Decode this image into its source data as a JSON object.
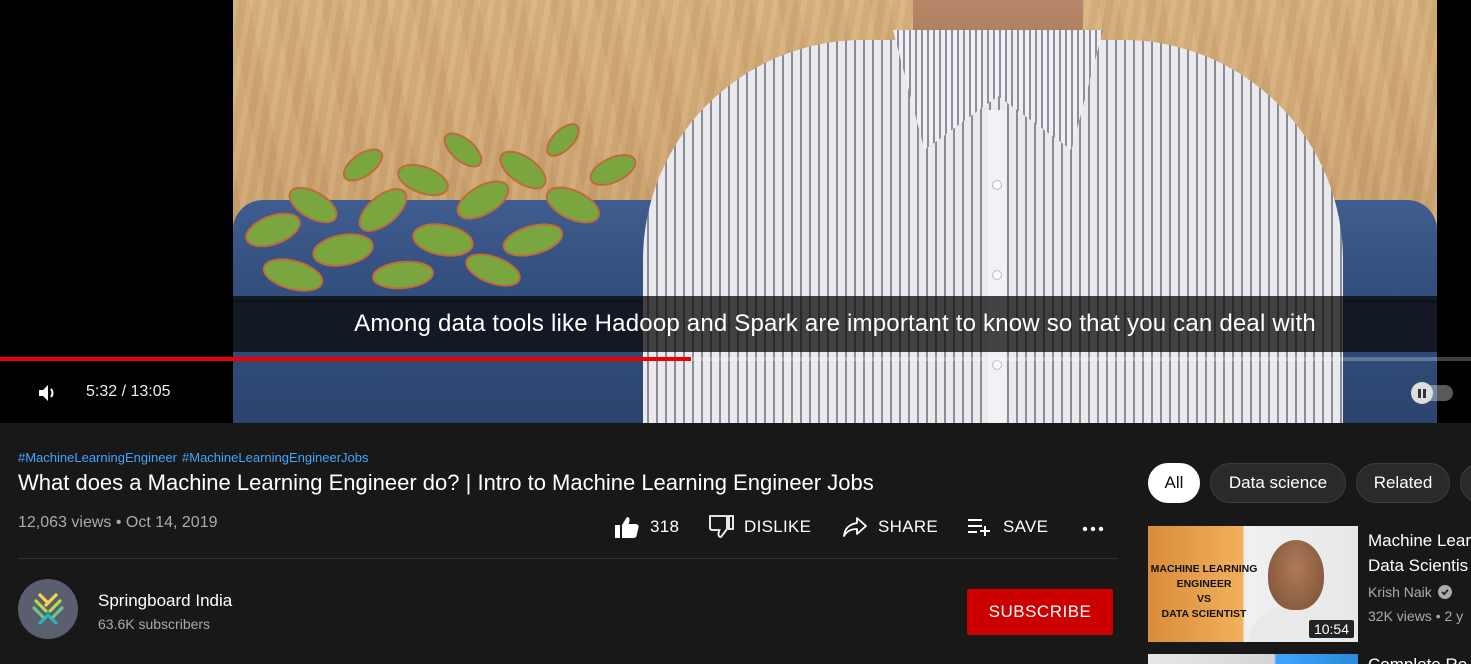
{
  "player": {
    "caption": "Among data tools like Hadoop and Spark are important to know so that you can deal with",
    "current_time": "5:32",
    "duration": "13:05",
    "time_display": "5:32 / 13:05",
    "progress_fraction": 0.47,
    "icons": {
      "volume": "volume-icon",
      "autoplay": "autoplay-toggle-icon"
    },
    "colors": {
      "progress": "#ee0000"
    }
  },
  "video": {
    "hashtags": [
      "#MachineLearningEngineer",
      "#MachineLearningEngineerJobs"
    ],
    "title": "What does a Machine Learning Engineer do? | Intro to Machine Learning Engineer Jobs",
    "views_date": "12,063 views • Oct 14, 2019",
    "actions": {
      "like_count": "318",
      "dislike_label": "DISLIKE",
      "share_label": "SHARE",
      "save_label": "SAVE"
    }
  },
  "channel": {
    "name": "Springboard India",
    "subscribers": "63.6K subscribers",
    "subscribe_label": "SUBSCRIBE",
    "colors": {
      "subscribe": "#cc0000"
    }
  },
  "chips": [
    "All",
    "Data science",
    "Related"
  ],
  "recommendations": [
    {
      "title": "Machine Learning Engineer Vs Data Scientist",
      "title_visible_line1": "Machine Lear",
      "title_visible_line2": "Data Scientis",
      "channel": "Krish Naik",
      "meta_visible": "32K views • 2 y",
      "duration": "10:54",
      "thumb_text": [
        "MACHINE LEARNING",
        "ENGINEER",
        "VS",
        "DATA SCIENTIST"
      ]
    },
    {
      "title_visible": "Complete Ro"
    }
  ]
}
